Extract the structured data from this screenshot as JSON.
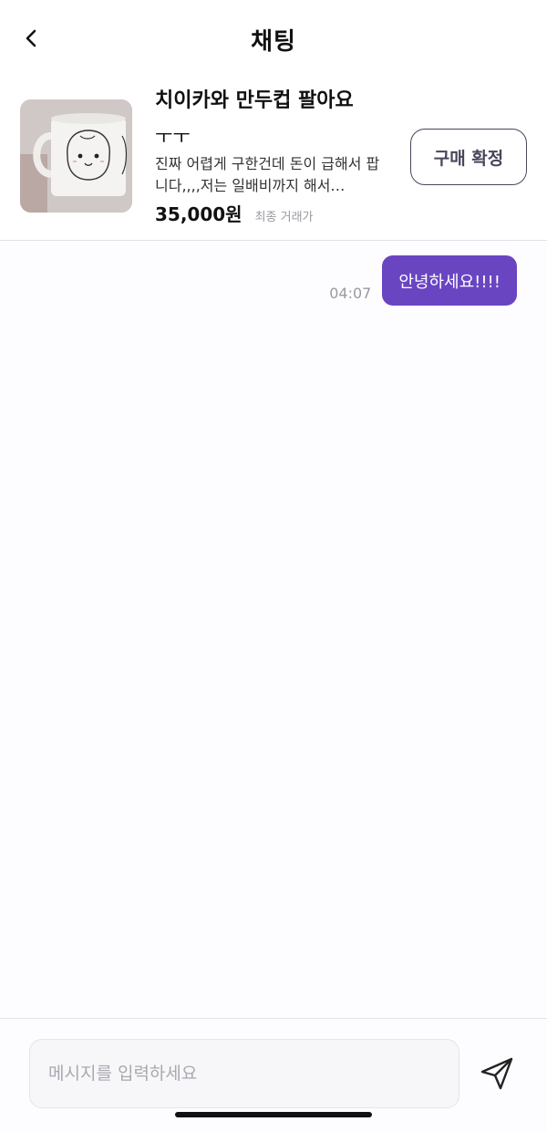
{
  "header": {
    "title": "채팅",
    "back_icon": "chevron-left-icon"
  },
  "product": {
    "title": "치이카와 만두컵 팔아요",
    "subtitle": "ㅜㅜ",
    "description": "진짜 어렵게 구한건데 돈이 급해서 팝니다,,,,저는 일배비까지 해서…",
    "price": "35,000원",
    "price_note": "최종 거래가",
    "confirm_label": "구매 확정",
    "image": "mug-photo"
  },
  "messages": [
    {
      "text": "안녕하세요!!!!",
      "time": "04:07",
      "sender": "me"
    }
  ],
  "composer": {
    "placeholder": "메시지를 입력하세요",
    "value": "",
    "send_icon": "send-icon"
  },
  "colors": {
    "accent": "#6a45c2",
    "confirm_border": "#4a4459",
    "background": "#fdfcfe"
  }
}
